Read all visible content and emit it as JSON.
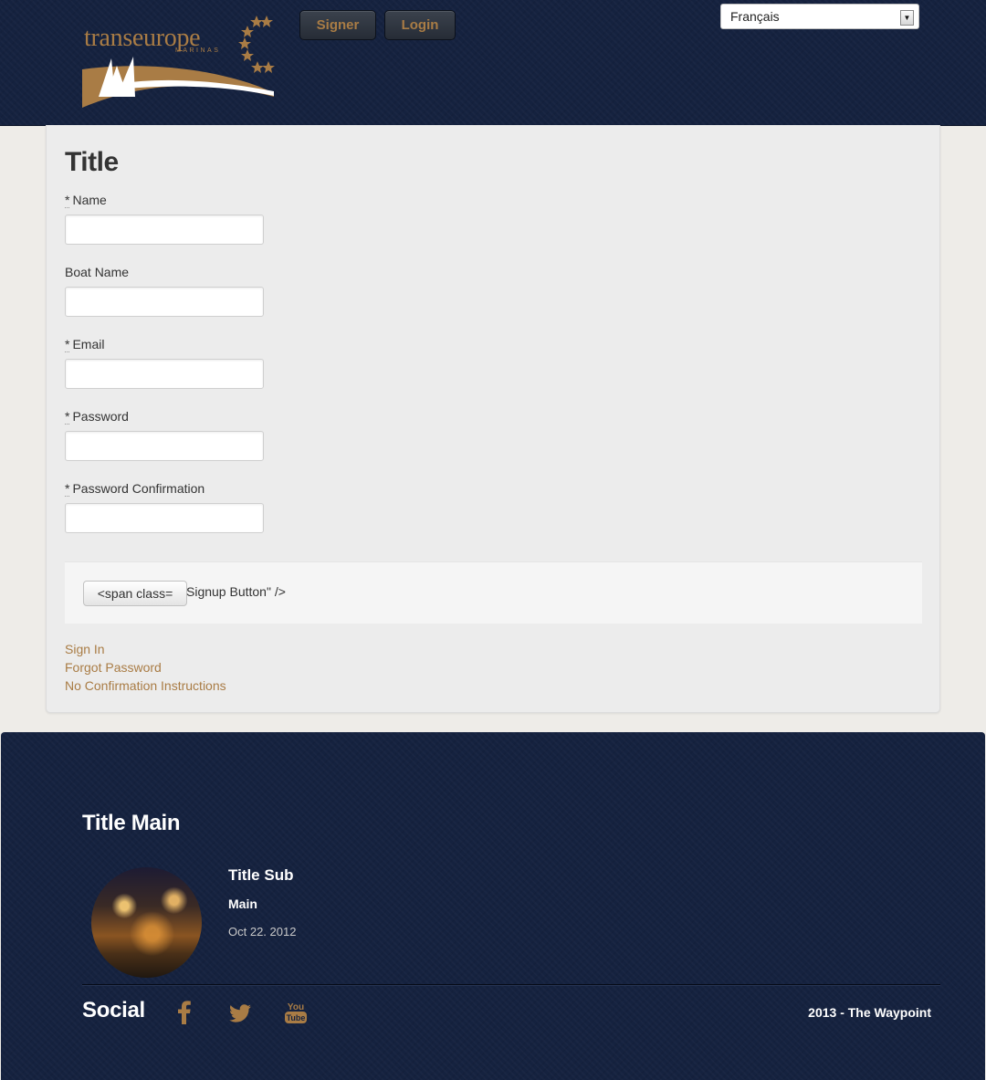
{
  "header": {
    "logo_text": "transeurope",
    "logo_subtext": "MARINAS",
    "nav": {
      "signer": "Signer",
      "login": "Login"
    },
    "language": "Français"
  },
  "form": {
    "title": "Title",
    "required_marker": "*",
    "fields": {
      "name": "Name",
      "boat_name": "Boat Name",
      "email": "Email",
      "password": "Password",
      "password_confirmation": "Password Confirmation"
    },
    "signup_button_label": "<span class=",
    "signup_trailing_text": "Signup Button\" />"
  },
  "links": {
    "sign_in": "Sign In",
    "forgot_password": "Forgot Password",
    "no_confirmation": "No Confirmation Instructions"
  },
  "footer": {
    "title": "Title Main",
    "post": {
      "title": "Title Sub",
      "main": "Main",
      "date": "Oct 22. 2012"
    },
    "social_title": "Social",
    "social_icons": [
      "facebook-icon",
      "twitter-icon",
      "youtube-icon"
    ],
    "copyright": "2013 - The Waypoint"
  },
  "colors": {
    "navy": "#15223f",
    "gold": "#a97c45",
    "panel": "#ececec",
    "page_bg": "#eeece8"
  }
}
